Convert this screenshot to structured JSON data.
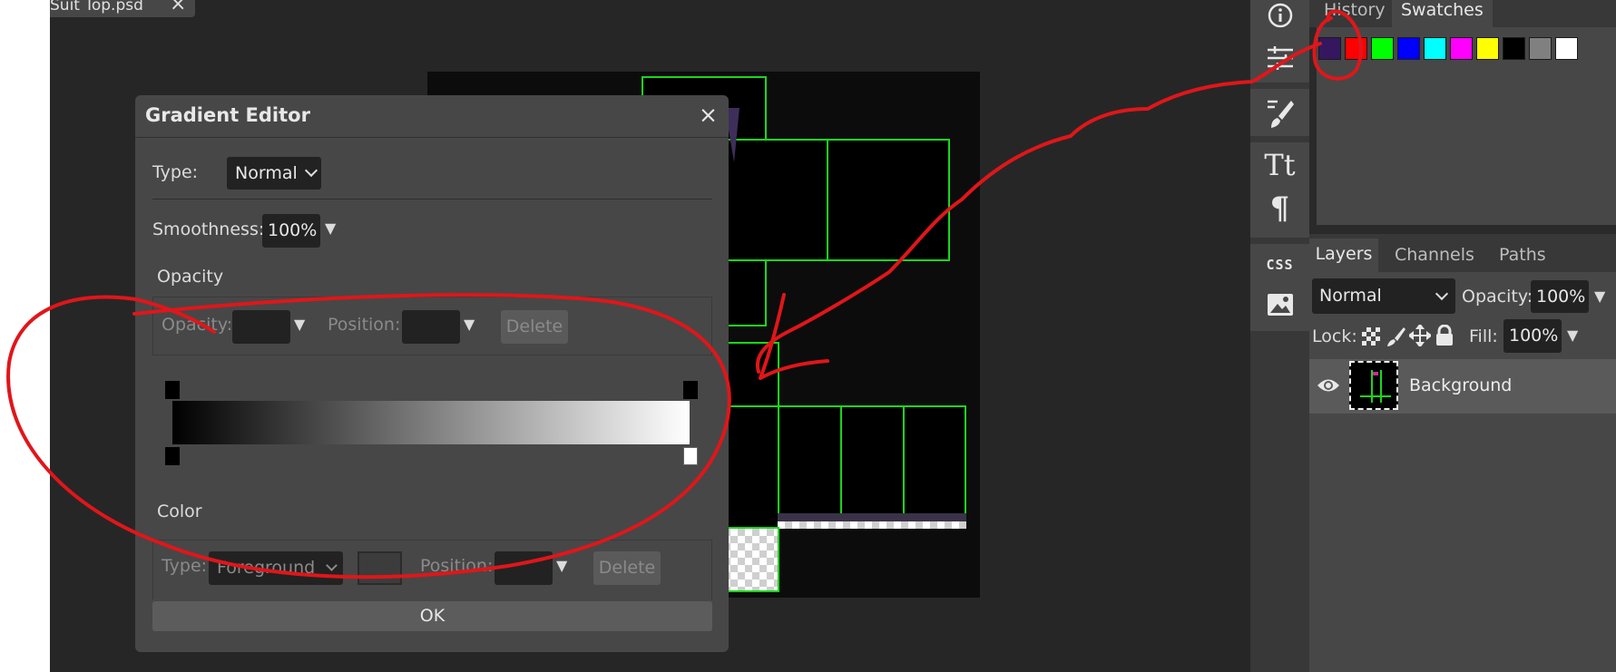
{
  "document": {
    "tab_name": "Suit Top.psd",
    "close_glyph": "×"
  },
  "dialog": {
    "title": "Gradient Editor",
    "close_glyph": "×",
    "type_label": "Type:",
    "type_value": "Normal",
    "smoothness_label": "Smoothness:",
    "smoothness_value": "100%",
    "opacity_section": "Opacity",
    "opacity_label": "Opacity:",
    "opacity_value": "",
    "position_label": "Position:",
    "position_value": "",
    "delete_label": "Delete",
    "color_section": "Color",
    "color_type_label": "Type:",
    "color_type_value": "Foreground",
    "color_position_label": "Position:",
    "color_position_value": "",
    "color_delete_label": "Delete",
    "ok_label": "OK",
    "gradient": {
      "start": "#000000",
      "end": "#ffffff"
    }
  },
  "right_panels": {
    "tabs": [
      "History",
      "Swatches"
    ],
    "active_tab": "Swatches",
    "swatches": [
      "#34175e",
      "#ff0000",
      "#00ff00",
      "#0000ff",
      "#00ffff",
      "#ff00ff",
      "#ffff00",
      "#000000",
      "#808080",
      "#ffffff"
    ],
    "layer_tabs": [
      "Layers",
      "Channels",
      "Paths"
    ],
    "blend_mode": "Normal",
    "opacity_label": "Opacity:",
    "opacity_value": "100%",
    "lock_label": "Lock:",
    "fill_label": "Fill:",
    "fill_value": "100%",
    "layers": [
      {
        "name": "Background",
        "visible": true
      }
    ]
  },
  "toolbar_icons": [
    "info-icon",
    "adjustments-icon",
    "brush-icon",
    "text-icon",
    "paragraph-icon",
    "css-icon",
    "image-icon"
  ],
  "toolbar_text": {
    "text_glyph": "Tt",
    "paragraph_glyph": "¶",
    "css_label": "CSS"
  },
  "colors": {
    "annotation": "#e0161a",
    "accent_green": "#18d818"
  }
}
